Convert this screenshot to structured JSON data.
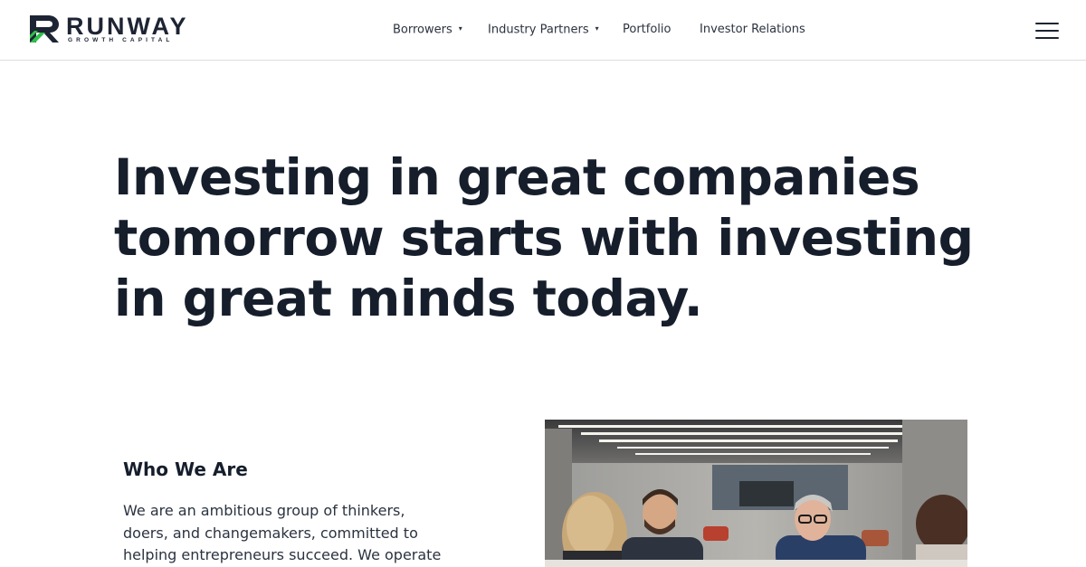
{
  "brand": {
    "name": "RUNWAY",
    "tagline": "GROWTH CAPITAL",
    "colors": {
      "green": "#2fbf4a",
      "dark": "#1d2433"
    }
  },
  "nav": {
    "items": [
      {
        "label": "Borrowers",
        "has_dropdown": true
      },
      {
        "label": "Industry Partners",
        "has_dropdown": true
      },
      {
        "label": "Portfolio",
        "has_dropdown": false
      },
      {
        "label": "Investor Relations",
        "has_dropdown": false
      }
    ],
    "caret": "▾",
    "menu_icon": "hamburger-menu-icon"
  },
  "hero": {
    "headline_lines": [
      "Investing in great companies",
      "tomorrow starts with investing",
      "in great minds today."
    ]
  },
  "who_we_are": {
    "title": "Who We Are",
    "body_lines": [
      "We are an ambitious group of thinkers,",
      "doers, and changemakers, committed to",
      "helping entrepreneurs succeed. We operate"
    ]
  },
  "photo": {
    "subject": "team meeting in office"
  }
}
